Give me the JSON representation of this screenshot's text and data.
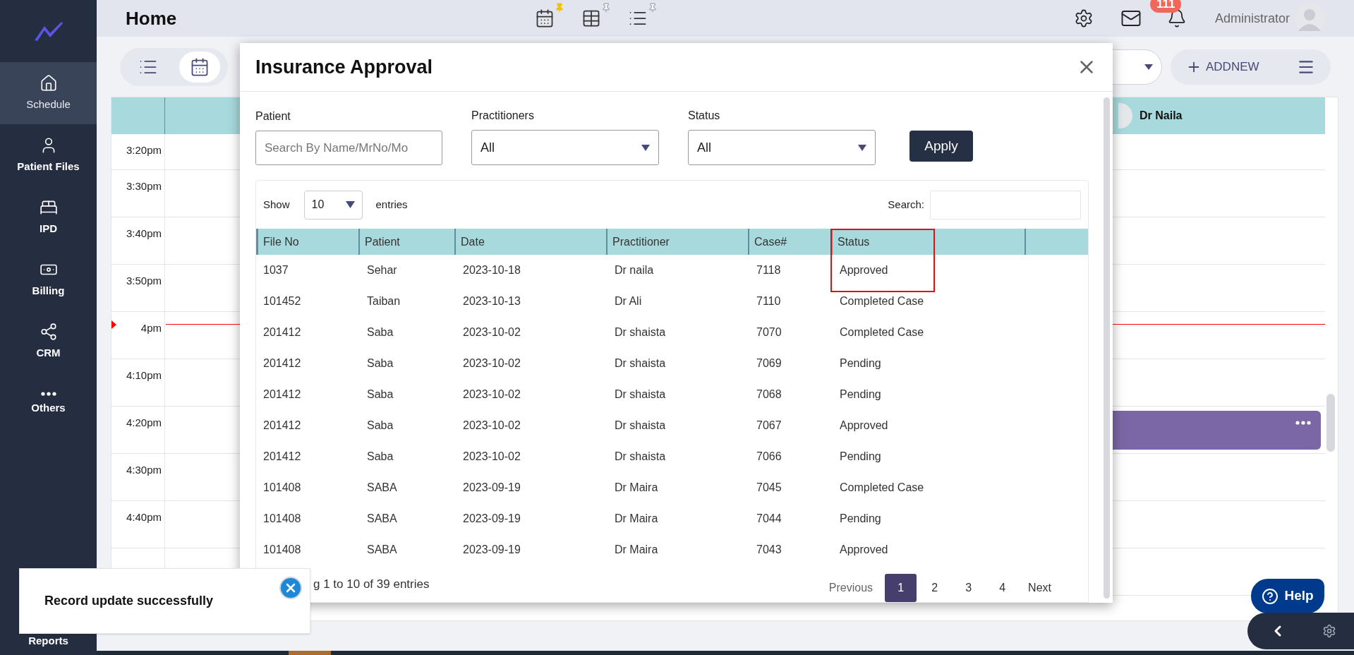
{
  "sidebar": {
    "items": [
      {
        "kind": "home",
        "label": "Schedule",
        "selected": true
      },
      {
        "kind": "person",
        "label": "Patient Files",
        "selected": false
      },
      {
        "kind": "bed",
        "label": "IPD",
        "selected": false
      },
      {
        "kind": "money",
        "label": "Billing",
        "selected": false
      },
      {
        "kind": "network",
        "label": "CRM",
        "selected": false
      },
      {
        "kind": "dots",
        "label": "Others",
        "selected": false
      }
    ],
    "bottom_item": "Reports"
  },
  "header": {
    "title": "Home",
    "views": [
      {
        "kind": "calendar",
        "pinned": true
      },
      {
        "kind": "table",
        "pinned": false
      },
      {
        "kind": "list",
        "pinned": false
      }
    ],
    "notification_count": "111",
    "user": "Administrator"
  },
  "toolbar": {
    "view_toggle": [
      {
        "kind": "list",
        "selected": false
      },
      {
        "kind": "calendar",
        "selected": true
      }
    ],
    "add_button": "ADDNEW"
  },
  "calendar": {
    "columns": [
      {
        "name": "Dr Naila"
      }
    ],
    "times": [
      "3:20pm",
      "3:30pm",
      "3:40pm",
      "3:50pm",
      "4pm",
      "4:10pm",
      "4:20pm",
      "4:30pm",
      "4:40pm"
    ]
  },
  "modal": {
    "title": "Insurance Approval",
    "filters": [
      {
        "kind": "text",
        "label": "Patient",
        "placeholder": "Search By Name/MrNo/Mo"
      },
      {
        "kind": "select",
        "label": "Practitioners",
        "value": "All"
      },
      {
        "kind": "select",
        "label": "Status",
        "value": "All"
      }
    ],
    "apply": "Apply",
    "table": {
      "show_label": "Show",
      "page_size": "10",
      "entries_label": "entries",
      "search_label": "Search:",
      "columns": [
        "File No",
        "Patient",
        "Date",
        "Practitioner",
        "Case#",
        "Status"
      ],
      "rows": [
        [
          "1037",
          "Sehar",
          "2023-10-18",
          "Dr naila",
          "7118",
          "Approved"
        ],
        [
          "101452",
          "Taiban",
          "2023-10-13",
          "Dr Ali",
          "7110",
          "Completed Case"
        ],
        [
          "201412",
          "Saba",
          "2023-10-02",
          "Dr shaista",
          "7070",
          "Completed Case"
        ],
        [
          "201412",
          "Saba",
          "2023-10-02",
          "Dr shaista",
          "7069",
          "Pending"
        ],
        [
          "201412",
          "Saba",
          "2023-10-02",
          "Dr shaista",
          "7068",
          "Pending"
        ],
        [
          "201412",
          "Saba",
          "2023-10-02",
          "Dr shaista",
          "7067",
          "Approved"
        ],
        [
          "201412",
          "Saba",
          "2023-10-02",
          "Dr shaista",
          "7066",
          "Pending"
        ],
        [
          "101408",
          "SABA",
          "2023-09-19",
          "Dr Maira",
          "7045",
          "Completed Case"
        ],
        [
          "101408",
          "SABA",
          "2023-09-19",
          "Dr Maira",
          "7044",
          "Pending"
        ],
        [
          "101408",
          "SABA",
          "2023-09-19",
          "Dr Maira",
          "7043",
          "Approved"
        ]
      ],
      "info": "g 1 to 10 of 39 entries",
      "pagination": {
        "previous": "Previous",
        "pages": [
          {
            "label": "1",
            "selected": true
          },
          {
            "label": "2",
            "selected": false
          },
          {
            "label": "3",
            "selected": false
          },
          {
            "label": "4",
            "selected": false
          }
        ],
        "next": "Next"
      }
    }
  },
  "toast": {
    "message": "Record update successfully"
  },
  "help": "Help"
}
